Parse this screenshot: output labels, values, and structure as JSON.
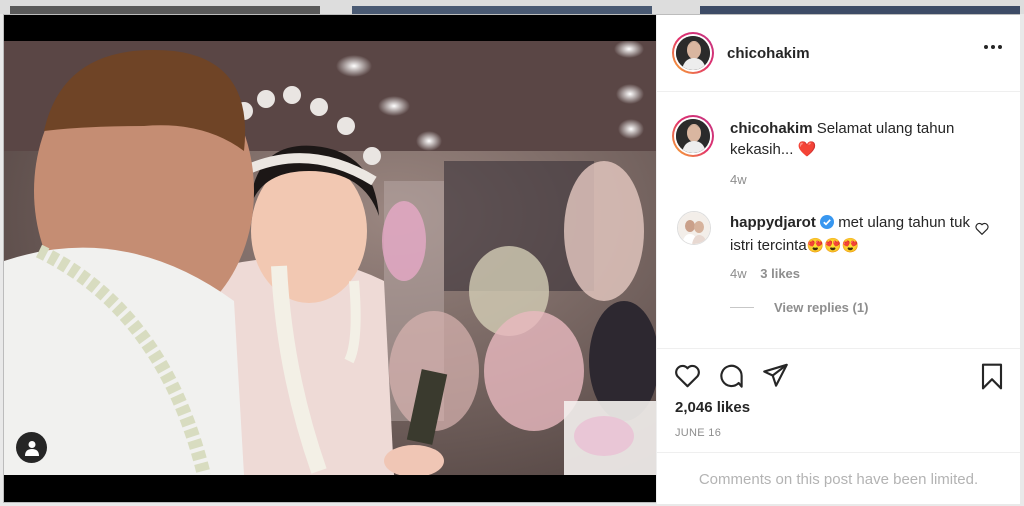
{
  "post": {
    "author": "chicohakim",
    "caption": {
      "username": "chicohakim",
      "text": "Selamat ulang tahun kekasih...",
      "emoji": "❤️",
      "age": "4w"
    },
    "comment": {
      "username": "happydjarot",
      "verified": true,
      "text": "met ulang tahun tuk istri tercinta",
      "emoji": "😍😍😍",
      "age": "4w",
      "likes": "3 likes",
      "view_replies": "View replies (1)"
    },
    "likes": "2,046 likes",
    "date": "JUNE 16",
    "comments_notice": "Comments on this post have been limited."
  },
  "icons": {
    "more": "more-options-icon",
    "like": "heart-icon",
    "comment": "comment-icon",
    "share": "paper-plane-icon",
    "save": "bookmark-icon",
    "verified": "verified-badge-icon",
    "profile": "user-profile-icon"
  },
  "colors": {
    "text": "#262626",
    "secondary": "#8e8e8e",
    "verified": "#3897f0",
    "heart": "#ed4956",
    "border": "#efefef"
  }
}
